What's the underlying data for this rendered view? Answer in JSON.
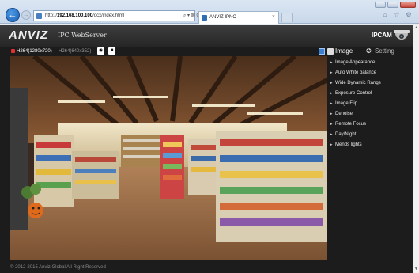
{
  "browser": {
    "url_prefix": "http://",
    "url_host": "192.168.100.100",
    "url_path": "/ocx/index.html",
    "addr_tools": "⌕ ▾ ⊠ C",
    "tab_title": "ANVIZ IPNC",
    "tab_close": "×"
  },
  "header": {
    "logo": "ANVIZ",
    "product": "IPC WebServer",
    "device": "IPCAM"
  },
  "toolbar": {
    "stream_main": "H264(1280x720)",
    "stream_sub": "H264(640x352)",
    "tab_image": "Image",
    "tab_setting": "Setting"
  },
  "panel": {
    "items": [
      "Image Appearance",
      "Auto White balance",
      "Wide Dynamic Range",
      "Exposure Control",
      "Image Flip",
      "Denoise",
      "Remote Focus",
      "Day/Night",
      "Mends lights"
    ]
  },
  "footer": {
    "copyright": "© 2012-2015 Anviz Global All Right Reserved"
  }
}
